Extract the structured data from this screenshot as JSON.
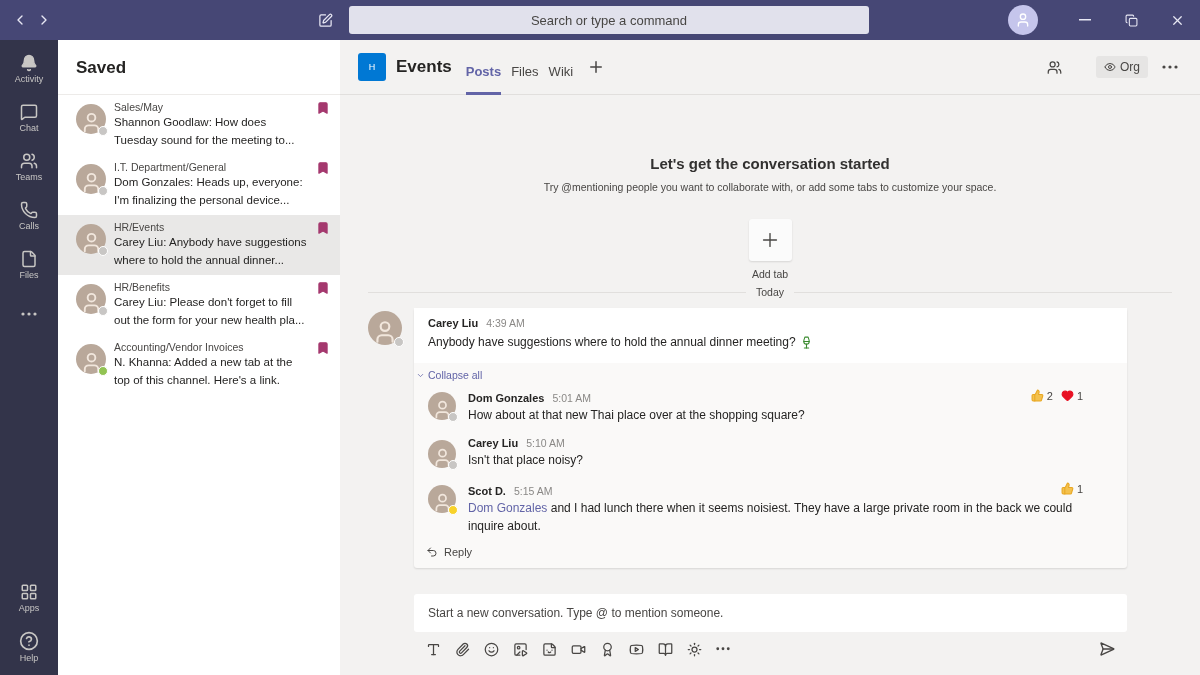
{
  "title_bar": {
    "search_placeholder": "Search or type a command"
  },
  "rail": {
    "items": [
      {
        "kind": "activity",
        "label": "Activity"
      },
      {
        "kind": "chat",
        "label": "Chat"
      },
      {
        "kind": "teams",
        "label": "Teams"
      },
      {
        "kind": "calls",
        "label": "Calls"
      },
      {
        "kind": "files",
        "label": "Files"
      },
      {
        "kind": "more"
      }
    ],
    "bottom_items": [
      {
        "kind": "apps",
        "label": "Apps"
      },
      {
        "kind": "help",
        "label": "Help"
      }
    ]
  },
  "saved": {
    "title": "Saved",
    "items": [
      {
        "channel": "Sales/May",
        "text": "Shannon Goodlaw: How does Tuesday sound for the meeting to...",
        "color": "#c8c6c4",
        "selected": false
      },
      {
        "channel": "I.T. Department/General",
        "text": "Dom Gonzales: Heads up, everyone: I'm finalizing the personal device...",
        "color": "#c8c6c4",
        "selected": false
      },
      {
        "channel": "HR/Events",
        "text": "Carey Liu: Anybody have suggestions where to hold the annual dinner...",
        "color": "#c8c6c4",
        "selected": true
      },
      {
        "channel": "HR/Benefits",
        "text": "Carey Liu: Please don't forget to fill out the form for your new health pla...",
        "color": "#c8c6c4",
        "selected": false
      },
      {
        "channel": "Accounting/Vendor Invoices",
        "text": "N. Khanna: Added a new tab at the top of this channel. Here's a link.",
        "color": "#92c353",
        "selected": false
      }
    ]
  },
  "channel": {
    "badge": "H",
    "name": "Events",
    "tabs": [
      {
        "label": "Posts",
        "selected": true
      },
      {
        "label": "Files",
        "selected": false
      },
      {
        "label": "Wiki",
        "selected": false
      }
    ],
    "org_label": "Org"
  },
  "empty_state": {
    "title": "Let's get the conversation started",
    "subtitle": "Try @mentioning people you want to collaborate with, or add some tabs to customize your space.",
    "add_tab_label": "Add tab"
  },
  "date_divider": "Today",
  "thread": {
    "root": {
      "author": "Carey Liu",
      "time": "4:39 AM",
      "text": "Anybody have suggestions where to hold the annual dinner meeting?",
      "color": "#c8c6c4"
    },
    "collapse_label": "Collapse all",
    "replies": [
      {
        "author": "Dom Gonzales",
        "time": "5:01 AM",
        "color": "#c8c6c4",
        "segments": [
          {
            "kind": "text",
            "text": "How about at that new Thai place over at the shopping square?"
          }
        ],
        "reactions": [
          {
            "kind": "like",
            "count": "2"
          },
          {
            "kind": "heart",
            "count": "1"
          }
        ]
      },
      {
        "author": "Carey Liu",
        "time": "5:10 AM",
        "color": "#c8c6c4",
        "segments": [
          {
            "kind": "text",
            "text": "Isn't that place noisy?"
          }
        ]
      },
      {
        "author": "Scot D.",
        "time": "5:15 AM",
        "color": "#f8d22a",
        "segments": [
          {
            "kind": "mention",
            "text": "Dom Gonzales"
          },
          {
            "kind": "text",
            "text": " and I had lunch there when it seems noisiest. They have a large private room in the back we could inquire about."
          }
        ],
        "reactions": [
          {
            "kind": "like",
            "count": "1"
          }
        ]
      }
    ],
    "reply_label": "Reply"
  },
  "composer": {
    "placeholder": "Start a new conversation. Type @ to mention someone."
  }
}
